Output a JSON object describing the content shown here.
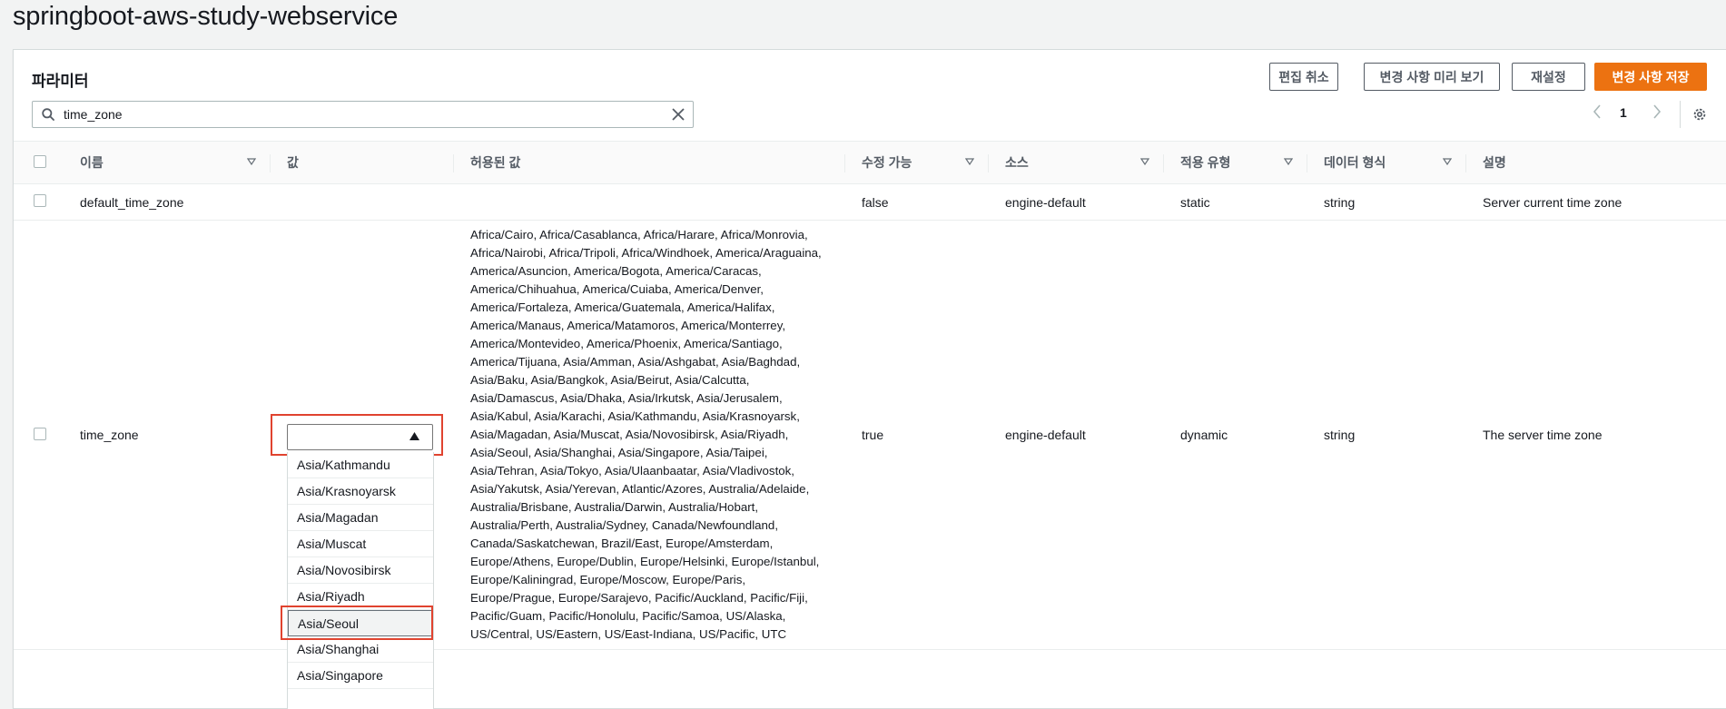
{
  "page_title": "springboot-aws-study-webservice",
  "panel": {
    "title": "파라미터",
    "buttons": {
      "cancel": "편집 취소",
      "preview": "변경 사항 미리 보기",
      "reset": "재설정",
      "save": "변경 사항 저장"
    },
    "search_value": "time_zone",
    "page_number": "1"
  },
  "columns": [
    "이름",
    "값",
    "허용된 값",
    "수정 가능",
    "소스",
    "적용 유형",
    "데이터 형식",
    "설명"
  ],
  "rows": [
    {
      "name": "default_time_zone",
      "value": "",
      "allowed": "",
      "modifiable": "false",
      "source": "engine-default",
      "apply_type": "static",
      "data_type": "string",
      "description": "Server current time zone"
    },
    {
      "name": "time_zone",
      "value": "",
      "allowed": "Africa/Cairo, Africa/Casablanca, Africa/Harare, Africa/Monrovia, Africa/Nairobi, Africa/Tripoli, Africa/Windhoek, America/Araguaina, America/Asuncion, America/Bogota, America/Caracas, America/Chihuahua, America/Cuiaba, America/Denver, America/Fortaleza, America/Guatemala, America/Halifax, America/Manaus, America/Matamoros, America/Monterrey, America/Montevideo, America/Phoenix, America/Santiago, America/Tijuana, Asia/Amman, Asia/Ashgabat, Asia/Baghdad, Asia/Baku, Asia/Bangkok, Asia/Beirut, Asia/Calcutta, Asia/Damascus, Asia/Dhaka, Asia/Irkutsk, Asia/Jerusalem, Asia/Kabul, Asia/Karachi, Asia/Kathmandu, Asia/Krasnoyarsk, Asia/Magadan, Asia/Muscat, Asia/Novosibirsk, Asia/Riyadh, Asia/Seoul, Asia/Shanghai, Asia/Singapore, Asia/Taipei, Asia/Tehran, Asia/Tokyo, Asia/Ulaanbaatar, Asia/Vladivostok, Asia/Yakutsk, Asia/Yerevan, Atlantic/Azores, Australia/Adelaide, Australia/Brisbane, Australia/Darwin, Australia/Hobart, Australia/Perth, Australia/Sydney, Canada/Newfoundland, Canada/Saskatchewan, Brazil/East, Europe/Amsterdam, Europe/Athens, Europe/Dublin, Europe/Helsinki, Europe/Istanbul, Europe/Kaliningrad, Europe/Moscow, Europe/Paris, Europe/Prague, Europe/Sarajevo, Pacific/Auckland, Pacific/Fiji, Pacific/Guam, Pacific/Honolulu, Pacific/Samoa, US/Alaska, US/Central, US/Eastern, US/East-Indiana, US/Pacific, UTC",
      "modifiable": "true",
      "source": "engine-default",
      "apply_type": "dynamic",
      "data_type": "string",
      "description": "The server time zone"
    }
  ],
  "dropdown_options": [
    "Asia/Kathmandu",
    "Asia/Krasnoyarsk",
    "Asia/Magadan",
    "Asia/Muscat",
    "Asia/Novosibirsk",
    "Asia/Riyadh",
    "Asia/Seoul",
    "Asia/Shanghai",
    "Asia/Singapore"
  ],
  "dropdown_selected": "Asia/Seoul",
  "colors": {
    "primary": "#ec7211",
    "highlight": "#e0432f",
    "text": "#16191f",
    "muted": "#545b64"
  }
}
